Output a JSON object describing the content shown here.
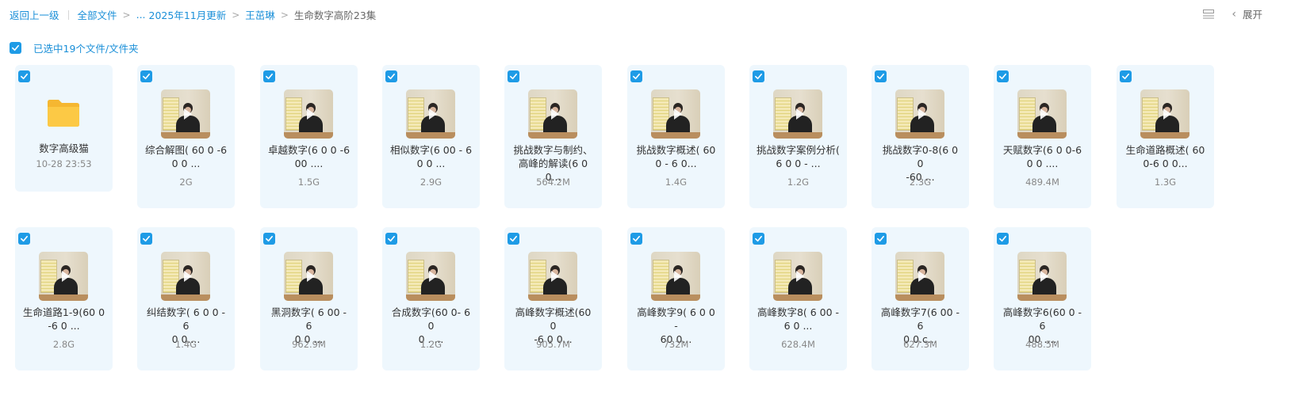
{
  "breadcrumb": {
    "back_label": "返回上一级",
    "all_files_label": "全部文件",
    "ellipsis": "...",
    "items": [
      "2025年11月更新",
      "王茁琳"
    ],
    "current": "生命数字高阶23集",
    "separator": ">"
  },
  "toolbar": {
    "expand_label": "展开",
    "list_icon": "list-view-icon",
    "chevron_icon": "chevron-left-icon"
  },
  "selection": {
    "label": "已选中19个文件/文件夹",
    "checked": true
  },
  "colors": {
    "accent": "#1e9be6",
    "card_bg": "#eef7fd",
    "link": "#1a8fd8"
  },
  "items": [
    {
      "type": "folder",
      "name": "数字高级猫",
      "meta": "10-28 23:53",
      "checked": true
    },
    {
      "type": "video",
      "name": "综合解图( 60 0 -6\n0 0 ...",
      "meta": "2G",
      "checked": true
    },
    {
      "type": "video",
      "name": "卓越数字(6 0 0 -6\n00 ....",
      "meta": "1.5G",
      "checked": true
    },
    {
      "type": "video",
      "name": "相似数字(6 00 - 6\n0 0 ...",
      "meta": "2.9G",
      "checked": true
    },
    {
      "type": "video",
      "name": "挑战数字与制约、\n高峰的解读(6 00...",
      "meta": "564.2M",
      "checked": true
    },
    {
      "type": "video",
      "name": "挑战数字概述( 60\n0 - 6 0...",
      "meta": "1.4G",
      "checked": true
    },
    {
      "type": "video",
      "name": "挑战数字案例分析(\n6 0 0 - ...",
      "meta": "1.2G",
      "checked": true
    },
    {
      "type": "video",
      "name": "挑战数字0-8(6 0 0\n-60 ...",
      "meta": "2.3G",
      "checked": true
    },
    {
      "type": "video",
      "name": "天赋数字(6 0 0-6\n0 0 ....",
      "meta": "489.4M",
      "checked": true
    },
    {
      "type": "video",
      "name": "生命道路概述( 60\n0-6 0 0...",
      "meta": "1.3G",
      "checked": true
    },
    {
      "type": "video",
      "name": "生命道路1-9(60 0\n-6 0 ...",
      "meta": "2.8G",
      "checked": true
    },
    {
      "type": "video",
      "name": "纠结数字( 6 0 0 -6\n0 0....",
      "meta": "1.4G",
      "checked": true
    },
    {
      "type": "video",
      "name": "黑洞数字( 6 00 - 6\n0 0 ...",
      "meta": "962.9M",
      "checked": true
    },
    {
      "type": "video",
      "name": "合成数字(60 0- 60\n0 . ...",
      "meta": "1.2G",
      "checked": true
    },
    {
      "type": "video",
      "name": "高峰数字概述(60 0\n-6 0 0...",
      "meta": "905.7M",
      "checked": true
    },
    {
      "type": "video",
      "name": "高峰数字9( 6 0 0 -\n60 0...",
      "meta": "732M",
      "checked": true
    },
    {
      "type": "video",
      "name": "高峰数字8( 6 00 -\n6 0 ...",
      "meta": "628.4M",
      "checked": true
    },
    {
      "type": "video",
      "name": "高峰数字7(6 00 -6\n0 0.c...",
      "meta": "627.3M",
      "checked": true
    },
    {
      "type": "video",
      "name": "高峰数字6(60 0 -6\n00 ....",
      "meta": "488.5M",
      "checked": true
    }
  ]
}
